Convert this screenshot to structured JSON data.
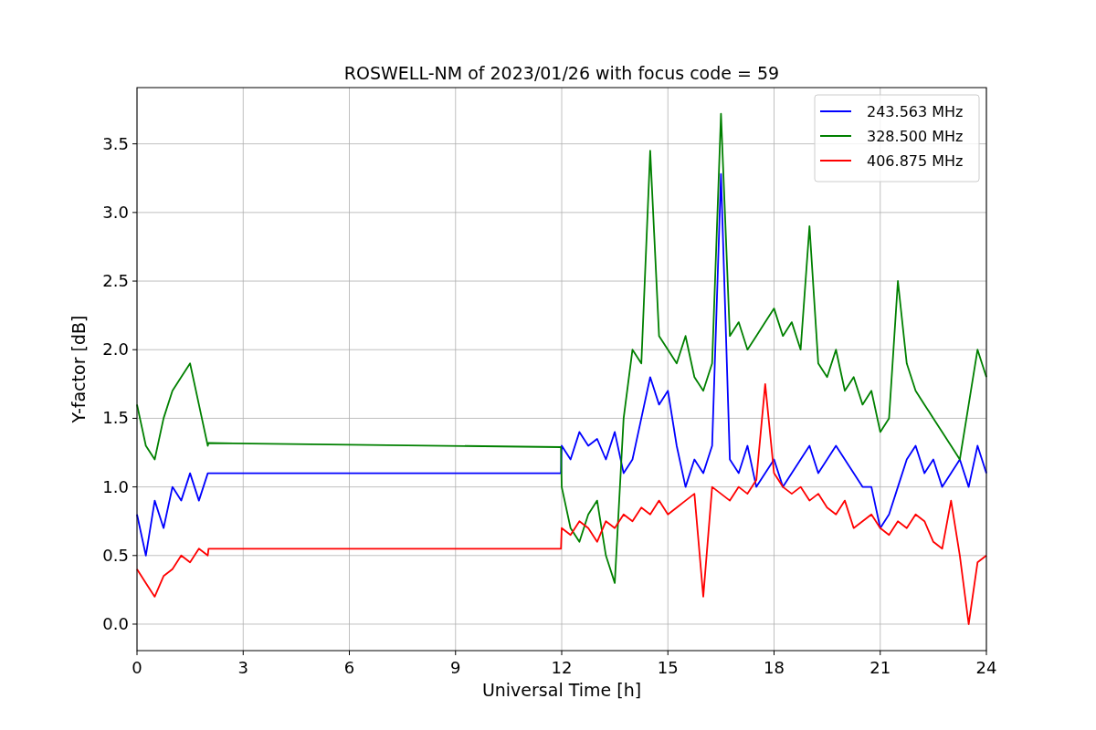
{
  "figure": {
    "chart_data": {
      "type": "line",
      "title": "ROSWELL-NM of 2023/01/26 with focus code = 59",
      "xlabel": "Universal Time [h]",
      "ylabel": "Y-factor [dB]",
      "x": [
        0,
        0.25,
        0.5,
        0.75,
        1,
        1.25,
        1.5,
        1.75,
        2,
        2.02,
        11.98,
        12,
        12.25,
        12.5,
        12.75,
        13,
        13.25,
        13.5,
        13.75,
        14,
        14.25,
        14.5,
        14.75,
        15,
        15.25,
        15.5,
        15.75,
        16,
        16.25,
        16.5,
        16.75,
        17,
        17.25,
        17.5,
        17.75,
        18,
        18.25,
        18.5,
        18.75,
        19,
        19.25,
        19.5,
        19.75,
        20,
        20.25,
        20.5,
        20.75,
        21,
        21.25,
        21.5,
        21.75,
        22,
        22.25,
        22.5,
        22.75,
        23,
        23.25,
        23.5,
        23.75,
        24
      ],
      "series": [
        {
          "name": "243.563 MHz",
          "color": "#0000ff",
          "values": [
            0.8,
            0.5,
            0.9,
            0.7,
            1.0,
            0.9,
            1.1,
            0.9,
            1.1,
            1.1,
            1.1,
            1.3,
            1.2,
            1.4,
            1.3,
            1.35,
            1.2,
            1.4,
            1.1,
            1.2,
            1.5,
            1.8,
            1.6,
            1.7,
            1.3,
            1.0,
            1.2,
            1.1,
            1.3,
            3.28,
            1.2,
            1.1,
            1.3,
            1.0,
            1.1,
            1.2,
            1.0,
            1.1,
            1.2,
            1.3,
            1.1,
            1.2,
            1.3,
            1.2,
            1.1,
            1.0,
            1.0,
            0.7,
            0.8,
            1.0,
            1.2,
            1.3,
            1.1,
            1.2,
            1.0,
            1.1,
            1.2,
            1.0,
            1.3,
            1.1
          ]
        },
        {
          "name": "328.500 MHz",
          "color": "#008000",
          "values": [
            1.6,
            1.3,
            1.2,
            1.5,
            1.7,
            1.8,
            1.9,
            1.6,
            1.3,
            1.32,
            1.29,
            1.0,
            0.7,
            0.6,
            0.8,
            0.9,
            0.5,
            0.3,
            1.5,
            2.0,
            1.9,
            3.45,
            2.1,
            2.0,
            1.9,
            2.1,
            1.8,
            1.7,
            1.9,
            3.72,
            2.1,
            2.2,
            2.0,
            2.1,
            2.2,
            2.3,
            2.1,
            2.2,
            2.0,
            2.9,
            1.9,
            1.8,
            2.0,
            1.7,
            1.8,
            1.6,
            1.7,
            1.4,
            1.5,
            2.5,
            1.9,
            1.7,
            1.6,
            1.5,
            1.4,
            1.3,
            1.2,
            1.6,
            2.0,
            1.8
          ]
        },
        {
          "name": "406.875 MHz",
          "color": "#ff0000",
          "values": [
            0.4,
            0.3,
            0.2,
            0.35,
            0.4,
            0.5,
            0.45,
            0.55,
            0.5,
            0.55,
            0.55,
            0.7,
            0.65,
            0.75,
            0.7,
            0.6,
            0.75,
            0.7,
            0.8,
            0.75,
            0.85,
            0.8,
            0.9,
            0.8,
            0.85,
            0.9,
            0.95,
            0.2,
            1.0,
            0.95,
            0.9,
            1.0,
            0.95,
            1.05,
            1.75,
            1.1,
            1.0,
            0.95,
            1.0,
            0.9,
            0.95,
            0.85,
            0.8,
            0.9,
            0.7,
            0.75,
            0.8,
            0.7,
            0.65,
            0.75,
            0.7,
            0.8,
            0.75,
            0.6,
            0.55,
            0.9,
            0.5,
            0.0,
            0.45,
            0.5
          ]
        }
      ],
      "grid": true,
      "legend": true,
      "xlim": [
        0,
        24
      ],
      "ylim": [
        -0.193,
        3.91
      ],
      "xticks": [
        0,
        3,
        6,
        9,
        12,
        15,
        18,
        21,
        24
      ],
      "yticks": [
        {
          "value": 0,
          "label": "0.0"
        },
        {
          "value": 0.5,
          "label": "0.5"
        },
        {
          "value": 1,
          "label": "1.0"
        },
        {
          "value": 1.5,
          "label": "1.5"
        },
        {
          "value": 2,
          "label": "2.0"
        },
        {
          "value": 2.5,
          "label": "2.5"
        },
        {
          "value": 3,
          "label": "3.0"
        },
        {
          "value": 3.5,
          "label": "3.5"
        }
      ]
    }
  }
}
